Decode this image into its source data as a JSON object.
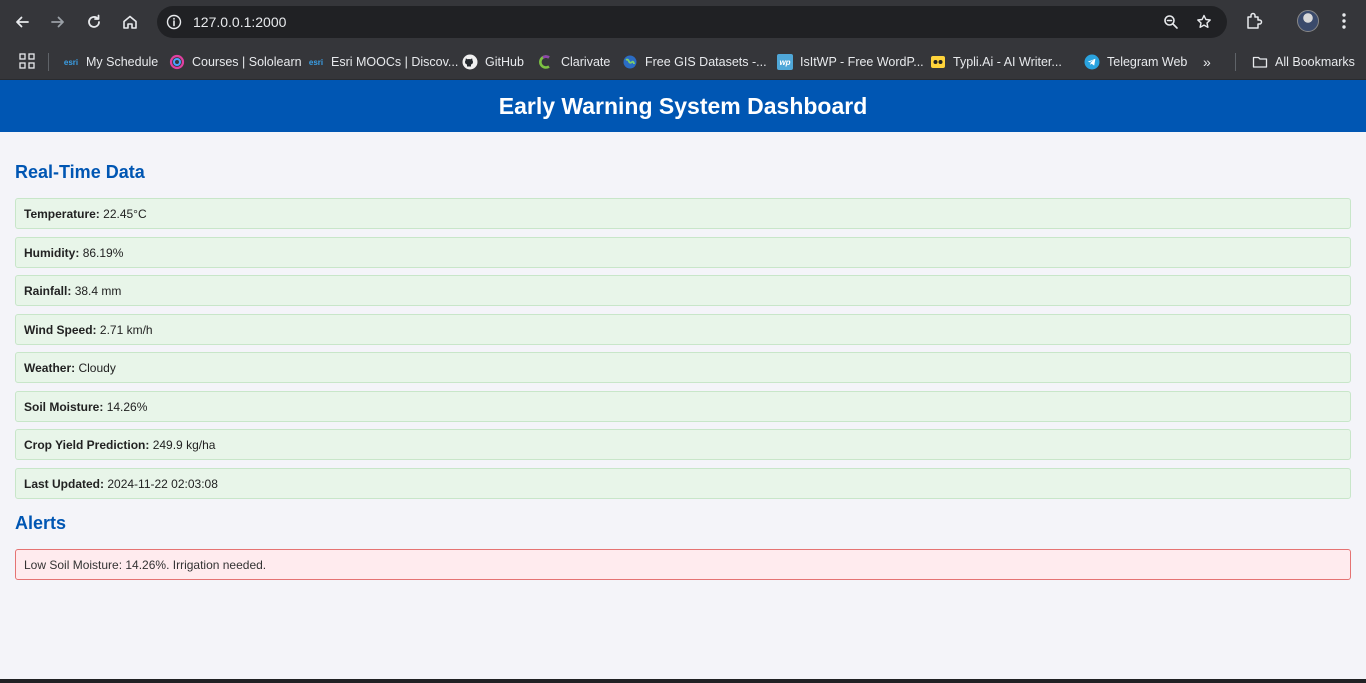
{
  "browser": {
    "url": "127.0.0.1:2000",
    "bookmarks": [
      {
        "label": "My Schedule",
        "icon": "esri-icon"
      },
      {
        "label": "Courses | Sololearn",
        "icon": "sololearn-icon"
      },
      {
        "label": "Esri MOOCs | Discov...",
        "icon": "esri-icon"
      },
      {
        "label": "GitHub",
        "icon": "github-icon"
      },
      {
        "label": "Clarivate",
        "icon": "clarivate-icon"
      },
      {
        "label": "Free GIS Datasets -...",
        "icon": "globe-icon"
      },
      {
        "label": "IsItWP - Free WordP...",
        "icon": "wp-icon"
      },
      {
        "label": "Typli.Ai - AI Writer...",
        "icon": "typli-icon"
      },
      {
        "label": "Telegram Web",
        "icon": "telegram-icon"
      }
    ],
    "more_label": "»",
    "all_bookmarks_label": "All Bookmarks",
    "esri_text": "esri",
    "wp_text": "wp"
  },
  "page": {
    "title": "Early Warning System Dashboard",
    "realtime_heading": "Real-Time Data",
    "alerts_heading": "Alerts",
    "readings": [
      {
        "label": "Temperature:",
        "value": "22.45°C"
      },
      {
        "label": "Humidity:",
        "value": "86.19%"
      },
      {
        "label": "Rainfall:",
        "value": "38.4 mm"
      },
      {
        "label": "Wind Speed:",
        "value": "2.71 km/h"
      },
      {
        "label": "Weather:",
        "value": "Cloudy"
      },
      {
        "label": "Soil Moisture:",
        "value": "14.26%"
      },
      {
        "label": "Crop Yield Prediction:",
        "value": "249.9 kg/ha"
      },
      {
        "label": "Last Updated:",
        "value": "2024-11-22 02:03:08"
      }
    ],
    "alerts": [
      "Low Soil Moisture: 14.26%. Irrigation needed."
    ]
  },
  "colors": {
    "header_bg": "#0056b3",
    "data_bg": "#e8f5e9",
    "alert_bg": "#ffebee",
    "alert_border": "#e57373"
  }
}
